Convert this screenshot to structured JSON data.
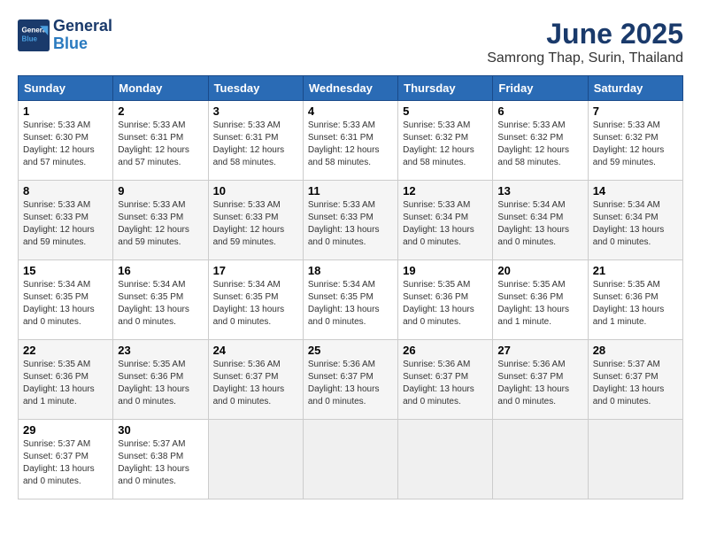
{
  "header": {
    "logo_line1": "General",
    "logo_line2": "Blue",
    "month": "June 2025",
    "location": "Samrong Thap, Surin, Thailand"
  },
  "weekdays": [
    "Sunday",
    "Monday",
    "Tuesday",
    "Wednesday",
    "Thursday",
    "Friday",
    "Saturday"
  ],
  "weeks": [
    [
      {
        "day": "1",
        "info": "Sunrise: 5:33 AM\nSunset: 6:30 PM\nDaylight: 12 hours\nand 57 minutes."
      },
      {
        "day": "2",
        "info": "Sunrise: 5:33 AM\nSunset: 6:31 PM\nDaylight: 12 hours\nand 57 minutes."
      },
      {
        "day": "3",
        "info": "Sunrise: 5:33 AM\nSunset: 6:31 PM\nDaylight: 12 hours\nand 58 minutes."
      },
      {
        "day": "4",
        "info": "Sunrise: 5:33 AM\nSunset: 6:31 PM\nDaylight: 12 hours\nand 58 minutes."
      },
      {
        "day": "5",
        "info": "Sunrise: 5:33 AM\nSunset: 6:32 PM\nDaylight: 12 hours\nand 58 minutes."
      },
      {
        "day": "6",
        "info": "Sunrise: 5:33 AM\nSunset: 6:32 PM\nDaylight: 12 hours\nand 58 minutes."
      },
      {
        "day": "7",
        "info": "Sunrise: 5:33 AM\nSunset: 6:32 PM\nDaylight: 12 hours\nand 59 minutes."
      }
    ],
    [
      {
        "day": "8",
        "info": "Sunrise: 5:33 AM\nSunset: 6:33 PM\nDaylight: 12 hours\nand 59 minutes."
      },
      {
        "day": "9",
        "info": "Sunrise: 5:33 AM\nSunset: 6:33 PM\nDaylight: 12 hours\nand 59 minutes."
      },
      {
        "day": "10",
        "info": "Sunrise: 5:33 AM\nSunset: 6:33 PM\nDaylight: 12 hours\nand 59 minutes."
      },
      {
        "day": "11",
        "info": "Sunrise: 5:33 AM\nSunset: 6:33 PM\nDaylight: 13 hours\nand 0 minutes."
      },
      {
        "day": "12",
        "info": "Sunrise: 5:33 AM\nSunset: 6:34 PM\nDaylight: 13 hours\nand 0 minutes."
      },
      {
        "day": "13",
        "info": "Sunrise: 5:34 AM\nSunset: 6:34 PM\nDaylight: 13 hours\nand 0 minutes."
      },
      {
        "day": "14",
        "info": "Sunrise: 5:34 AM\nSunset: 6:34 PM\nDaylight: 13 hours\nand 0 minutes."
      }
    ],
    [
      {
        "day": "15",
        "info": "Sunrise: 5:34 AM\nSunset: 6:35 PM\nDaylight: 13 hours\nand 0 minutes."
      },
      {
        "day": "16",
        "info": "Sunrise: 5:34 AM\nSunset: 6:35 PM\nDaylight: 13 hours\nand 0 minutes."
      },
      {
        "day": "17",
        "info": "Sunrise: 5:34 AM\nSunset: 6:35 PM\nDaylight: 13 hours\nand 0 minutes."
      },
      {
        "day": "18",
        "info": "Sunrise: 5:34 AM\nSunset: 6:35 PM\nDaylight: 13 hours\nand 0 minutes."
      },
      {
        "day": "19",
        "info": "Sunrise: 5:35 AM\nSunset: 6:36 PM\nDaylight: 13 hours\nand 0 minutes."
      },
      {
        "day": "20",
        "info": "Sunrise: 5:35 AM\nSunset: 6:36 PM\nDaylight: 13 hours\nand 1 minute."
      },
      {
        "day": "21",
        "info": "Sunrise: 5:35 AM\nSunset: 6:36 PM\nDaylight: 13 hours\nand 1 minute."
      }
    ],
    [
      {
        "day": "22",
        "info": "Sunrise: 5:35 AM\nSunset: 6:36 PM\nDaylight: 13 hours\nand 1 minute."
      },
      {
        "day": "23",
        "info": "Sunrise: 5:35 AM\nSunset: 6:36 PM\nDaylight: 13 hours\nand 0 minutes."
      },
      {
        "day": "24",
        "info": "Sunrise: 5:36 AM\nSunset: 6:37 PM\nDaylight: 13 hours\nand 0 minutes."
      },
      {
        "day": "25",
        "info": "Sunrise: 5:36 AM\nSunset: 6:37 PM\nDaylight: 13 hours\nand 0 minutes."
      },
      {
        "day": "26",
        "info": "Sunrise: 5:36 AM\nSunset: 6:37 PM\nDaylight: 13 hours\nand 0 minutes."
      },
      {
        "day": "27",
        "info": "Sunrise: 5:36 AM\nSunset: 6:37 PM\nDaylight: 13 hours\nand 0 minutes."
      },
      {
        "day": "28",
        "info": "Sunrise: 5:37 AM\nSunset: 6:37 PM\nDaylight: 13 hours\nand 0 minutes."
      }
    ],
    [
      {
        "day": "29",
        "info": "Sunrise: 5:37 AM\nSunset: 6:37 PM\nDaylight: 13 hours\nand 0 minutes."
      },
      {
        "day": "30",
        "info": "Sunrise: 5:37 AM\nSunset: 6:38 PM\nDaylight: 13 hours\nand 0 minutes."
      },
      {
        "day": "",
        "info": ""
      },
      {
        "day": "",
        "info": ""
      },
      {
        "day": "",
        "info": ""
      },
      {
        "day": "",
        "info": ""
      },
      {
        "day": "",
        "info": ""
      }
    ]
  ]
}
